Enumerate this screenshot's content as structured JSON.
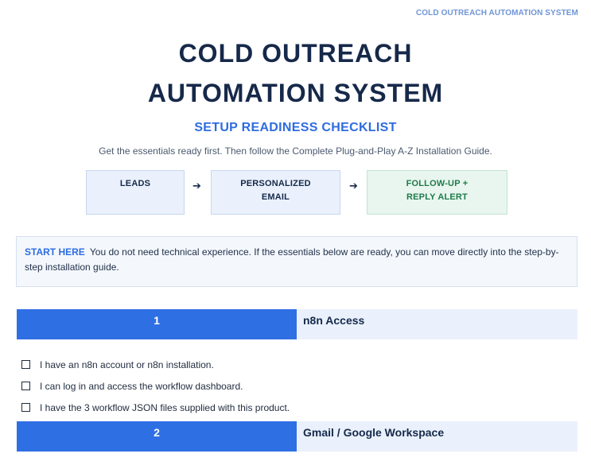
{
  "header": {
    "tag": "COLD OUTREACH AUTOMATION SYSTEM"
  },
  "title": {
    "line1": "COLD OUTREACH",
    "line2": "AUTOMATION SYSTEM"
  },
  "subtitle": "SETUP READINESS CHECKLIST",
  "intro": "Get the essentials ready first. Then follow the Complete Plug-and-Play A-Z Installation Guide.",
  "flow": {
    "steps": [
      {
        "line1": "LEADS",
        "line2": ""
      },
      {
        "line1": "PERSONALIZED",
        "line2": "EMAIL"
      },
      {
        "line1": "FOLLOW-UP +",
        "line2": "REPLY ALERT"
      }
    ],
    "arrow": "➔"
  },
  "callout": {
    "lead": "START HERE",
    "text": "You do not need technical experience. If the essentials below are ready, you can move directly into the step-by-step installation guide."
  },
  "sections": [
    {
      "number": "1",
      "label": "n8n Access",
      "items": [
        "I have an n8n account or n8n installation.",
        "I can log in and access the workflow dashboard.",
        "I have the 3 workflow JSON files supplied with this product."
      ]
    },
    {
      "number": "2",
      "label": "Gmail / Google Workspace",
      "items": []
    }
  ],
  "colors": {
    "accent": "#2f6fe4",
    "navy": "#16294a",
    "green": "#1f7a4a"
  }
}
